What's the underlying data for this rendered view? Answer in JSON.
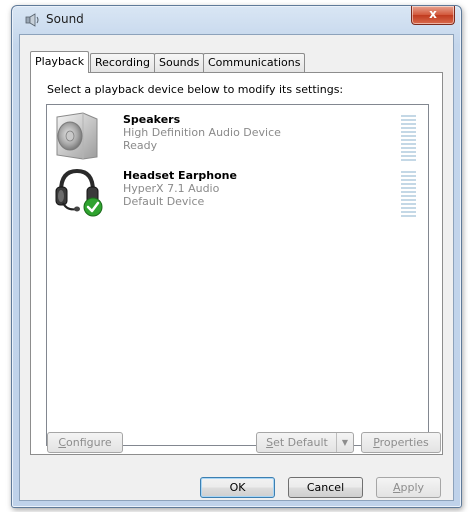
{
  "window": {
    "title": "Sound",
    "close_glyph": "x"
  },
  "tabs": [
    {
      "label": "Playback",
      "active": true
    },
    {
      "label": "Recording",
      "active": false
    },
    {
      "label": "Sounds",
      "active": false
    },
    {
      "label": "Communications",
      "active": false
    }
  ],
  "playback": {
    "instruction": "Select a playback device below to modify its settings:",
    "devices": [
      {
        "name": "Speakers",
        "description": "High Definition Audio Device",
        "status": "Ready",
        "icon": "speaker-icon"
      },
      {
        "name": "Headset Earphone",
        "description": "HyperX 7.1 Audio",
        "status": "Default Device",
        "icon": "headset-icon",
        "default_badge": "check-icon"
      }
    ],
    "configure": {
      "prefix": "",
      "accel": "C",
      "rest": "onfigure"
    },
    "set_default": {
      "prefix": "",
      "accel": "S",
      "rest": "et Default"
    },
    "properties": {
      "prefix": "",
      "accel": "P",
      "rest": "roperties"
    }
  },
  "dialog_buttons": {
    "ok": "OK",
    "cancel": "Cancel",
    "apply": {
      "prefix": "",
      "accel": "A",
      "rest": "pply"
    }
  },
  "colors": {
    "meter_bar": "#c4d8e6",
    "default_check": "#2fa32f"
  }
}
